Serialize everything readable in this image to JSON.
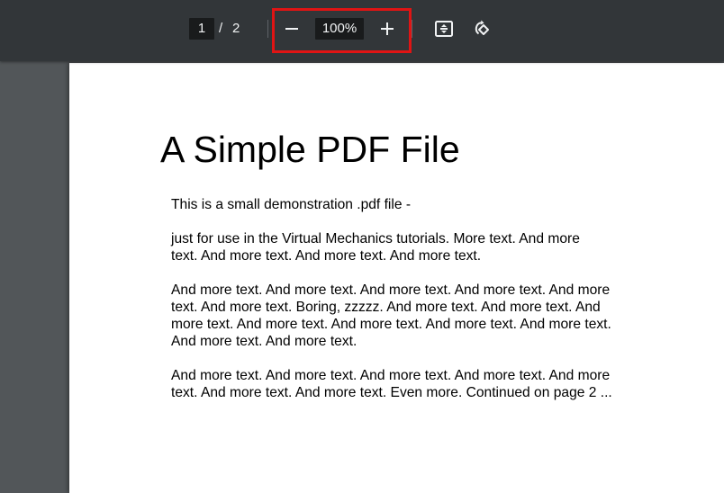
{
  "toolbar": {
    "page_current": "1",
    "page_separator": "/",
    "page_total": "2",
    "zoom_value": "100%",
    "icons": {
      "zoom_out": "minus-icon",
      "zoom_in": "plus-icon",
      "fit": "fit-to-page-icon",
      "rotate": "rotate-counterclockwise-icon"
    }
  },
  "colors": {
    "toolbar_bg": "#323639",
    "viewer_bg": "#525659",
    "highlight": "#e01414",
    "page_bg": "#ffffff"
  },
  "document": {
    "title": "A Simple PDF File",
    "paragraphs": [
      [
        "This is a small demonstration .pdf file -"
      ],
      [
        "just for use in the Virtual Mechanics tutorials. More text. And more",
        "text. And more text. And more text. And more text."
      ],
      [
        "And more text. And more text. And more text. And more text. And more",
        "text. And more text. Boring, zzzzz. And more text. And more text. And",
        "more text. And more text. And more text. And more text. And more text.",
        "And more text. And more text."
      ],
      [
        "And more text. And more text. And more text. And more text. And more",
        "text. And more text. And more text. Even more. Continued on page 2 ..."
      ]
    ]
  }
}
